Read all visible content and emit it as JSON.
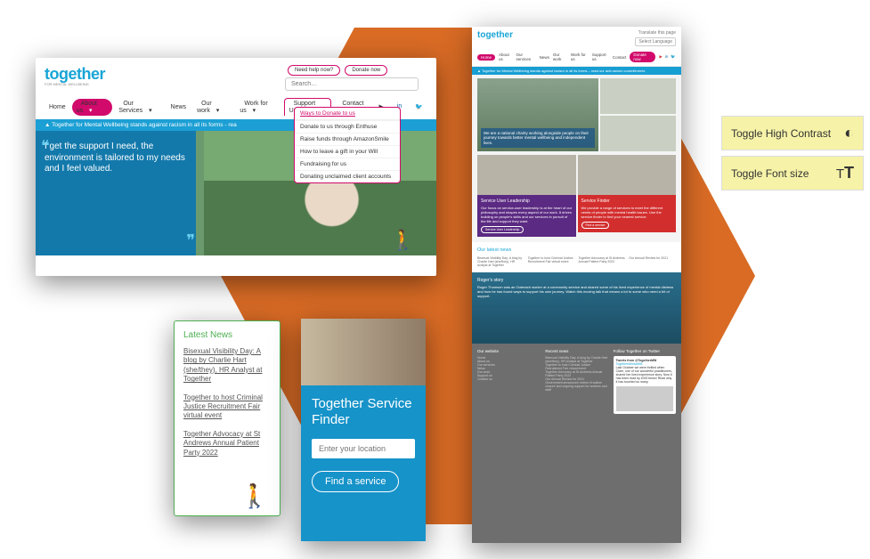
{
  "main": {
    "logo": "together",
    "logo_sub": "FOR MENTAL WELLBEING",
    "buttons": {
      "help": "Need help now?",
      "donate": "Donate now"
    },
    "search_placeholder": "Search…",
    "nav": {
      "home": "Home",
      "about": "About us",
      "services": "Our Services",
      "news": "News",
      "ourwork": "Our work",
      "workforus": "Work for us",
      "support": "Support Us",
      "contact": "Contact"
    },
    "banner": "▲  Together for Mental Wellbeing stands against racism in all its forms - rea",
    "quote": "I get the support I need, the environment is tailored to my needs and I feel valued.",
    "dropdown": {
      "header": "Ways to Donate to us",
      "items": [
        "Donate to us through Enthuse",
        "Raise funds through AmazonSmile",
        "How to leave a gift in your Will",
        "Fundraising for us",
        "Donating unclaimed client accounts"
      ]
    }
  },
  "mini": {
    "topbar": {
      "translate": "Translate this page",
      "lang": "Select Language"
    },
    "nav": [
      "Home",
      "About us",
      "Our services",
      "News",
      "Our work",
      "Work for us",
      "Support us",
      "Contact"
    ],
    "donate": "Donate now",
    "bar": "▲  Together for Mental Wellbeing stands against racism in all its forms – read our anti-racism commitments",
    "hero_cap": "We are a national charity working alongside people on their journey towards better mental wellbeing and independent lives.",
    "card1": {
      "title": "Service User Leadership",
      "body": "Our focus on service-user leadership is at the heart of our philosophy and shapes every aspect of our work. It drives building on people's skills and our services in pursuit of the life and support they want.",
      "btn": "Service User Leadership"
    },
    "card2": {
      "title": "Service Finder",
      "body": "We provide a range of services to meet the different needs of people with mental health issues. Use the service finder to find your nearest service.",
      "btn": "Find a service"
    },
    "news_title": "Our latest news",
    "news": [
      "Bisexual Visibility Day: A blog by Charlie Hart (she/they), HR Analyst at Together",
      "Together to host Criminal Justice Recruitment Fair virtual event",
      "Together Advocacy at St Andrews Annual Patient Party 2022",
      "Our Annual Review for 2021"
    ],
    "story_title": "Roger's story",
    "story_body": "Roger Thomson was an Outreach worker at a community service and shared some of his lived experience of mental distress and how he has found ways to support his own journey. Watch this moving talk that means a lot to some who need a bit of support.",
    "footer": {
      "col1_title": "Our website",
      "col1": [
        "Home",
        "About us",
        "Our services",
        "News",
        "Our work",
        "Support us",
        "Contact us"
      ],
      "col2_title": "Recent news",
      "col2_extra": "Government announces review of autism closure and ongoing support for workers and staff",
      "col3_title": "Follow Together on Twitter",
      "tweet_from": "Tweets from @TogetherMW",
      "tweet_handle": "TogetherMentalWB",
      "tweet_body": "Last October we were thrilled when Clare, one of our wonderful practitioners, shared her lived experience story. Now it has been read by 4000 times! Read why it has touched so many."
    }
  },
  "latest": {
    "title": "Latest News",
    "items": [
      "Bisexual Visibility Day: A blog by Charlie Hart (she/they), HR Analyst at Together",
      "Together to host Criminal Justice Recruitment Fair virtual event",
      "Together Advocacy at St Andrews Annual Patient Party 2022"
    ]
  },
  "finder": {
    "title": "Together Service Finder",
    "placeholder": "Enter your location",
    "button": "Find a service"
  },
  "a11y": {
    "contrast": "Toggle High Contrast",
    "font": "Toggle Font size"
  }
}
